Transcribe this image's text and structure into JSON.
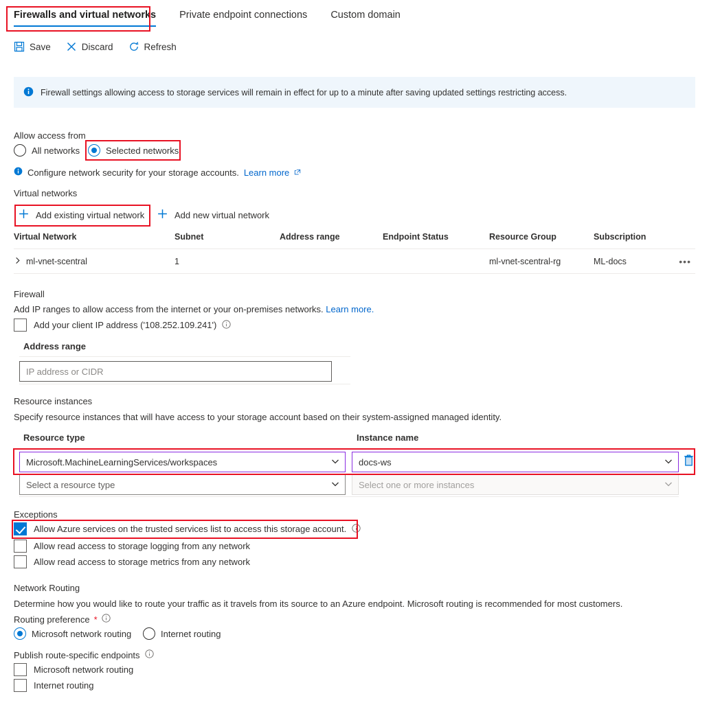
{
  "tabs": [
    {
      "label": "Firewalls and virtual networks",
      "active": true
    },
    {
      "label": "Private endpoint connections",
      "active": false
    },
    {
      "label": "Custom domain",
      "active": false
    }
  ],
  "commandbar": {
    "save": {
      "label": "Save",
      "icon": "save-icon"
    },
    "discard": {
      "label": "Discard",
      "icon": "discard-x-icon"
    },
    "refresh": {
      "label": "Refresh",
      "icon": "refresh-icon"
    }
  },
  "banner": {
    "icon": "info-icon",
    "text": "Firewall settings allowing access to storage services will remain in effect for up to a minute after saving updated settings restricting access."
  },
  "allow_access": {
    "heading": "Allow access from",
    "options": [
      {
        "label": "All networks",
        "selected": false
      },
      {
        "label": "Selected networks",
        "selected": true
      }
    ],
    "note_text": "Configure network security for your storage accounts.",
    "note_link": "Learn more"
  },
  "virtual_networks": {
    "heading": "Virtual networks",
    "add_existing_label": "Add existing virtual network",
    "add_new_label": "Add new virtual network",
    "columns": [
      "Virtual Network",
      "Subnet",
      "Address range",
      "Endpoint Status",
      "Resource Group",
      "Subscription"
    ],
    "rows": [
      {
        "name": "ml-vnet-scentral",
        "subnet": "1",
        "address_range": "",
        "endpoint_status": "",
        "resource_group": "ml-vnet-scentral-rg",
        "subscription": "ML-docs",
        "menu": "•••"
      }
    ]
  },
  "firewall": {
    "heading": "Firewall",
    "description": "Add IP ranges to allow access from the internet or your on-premises networks.",
    "description_link": "Learn more.",
    "client_ip_label": "Add your client IP address ('108.252.109.241')",
    "client_ip_checked": false,
    "address_range_label": "Address range",
    "address_range_placeholder": "IP address or CIDR",
    "address_range_value": ""
  },
  "resource_instances": {
    "heading": "Resource instances",
    "description": "Specify resource instances that will have access to your storage account based on their system-assigned managed identity.",
    "col_resource_type": "Resource type",
    "col_instance_name": "Instance name",
    "rows": [
      {
        "resource_type": "Microsoft.MachineLearningServices/workspaces",
        "instance_name": "docs-ws",
        "filled": true,
        "delete_icon": "delete-trash-icon"
      },
      {
        "resource_type": "Select a resource type",
        "instance_name": "Select one or more instances",
        "filled": false
      }
    ]
  },
  "exceptions": {
    "heading": "Exceptions",
    "items": [
      {
        "label": "Allow Azure services on the trusted services list to access this storage account.",
        "checked": true,
        "has_info": true
      },
      {
        "label": "Allow read access to storage logging from any network",
        "checked": false,
        "has_info": false
      },
      {
        "label": "Allow read access to storage metrics from any network",
        "checked": false,
        "has_info": false
      }
    ]
  },
  "network_routing": {
    "heading": "Network Routing",
    "description": "Determine how you would like to route your traffic as it travels from its source to an Azure endpoint. Microsoft routing is recommended for most customers.",
    "routing_preference_label": "Routing preference",
    "required_marker": "*",
    "routing_options": [
      {
        "label": "Microsoft network routing",
        "selected": true
      },
      {
        "label": "Internet routing",
        "selected": false
      }
    ],
    "publish_label": "Publish route-specific endpoints",
    "publish_options": [
      {
        "label": "Microsoft network routing",
        "checked": false
      },
      {
        "label": "Internet routing",
        "checked": false
      }
    ]
  },
  "colors": {
    "accent": "#0078d4",
    "annotation": "#e81123",
    "link": "#0066cc",
    "banner_bg": "#eff6fc",
    "dropdown_focus": "#8a2be2"
  }
}
